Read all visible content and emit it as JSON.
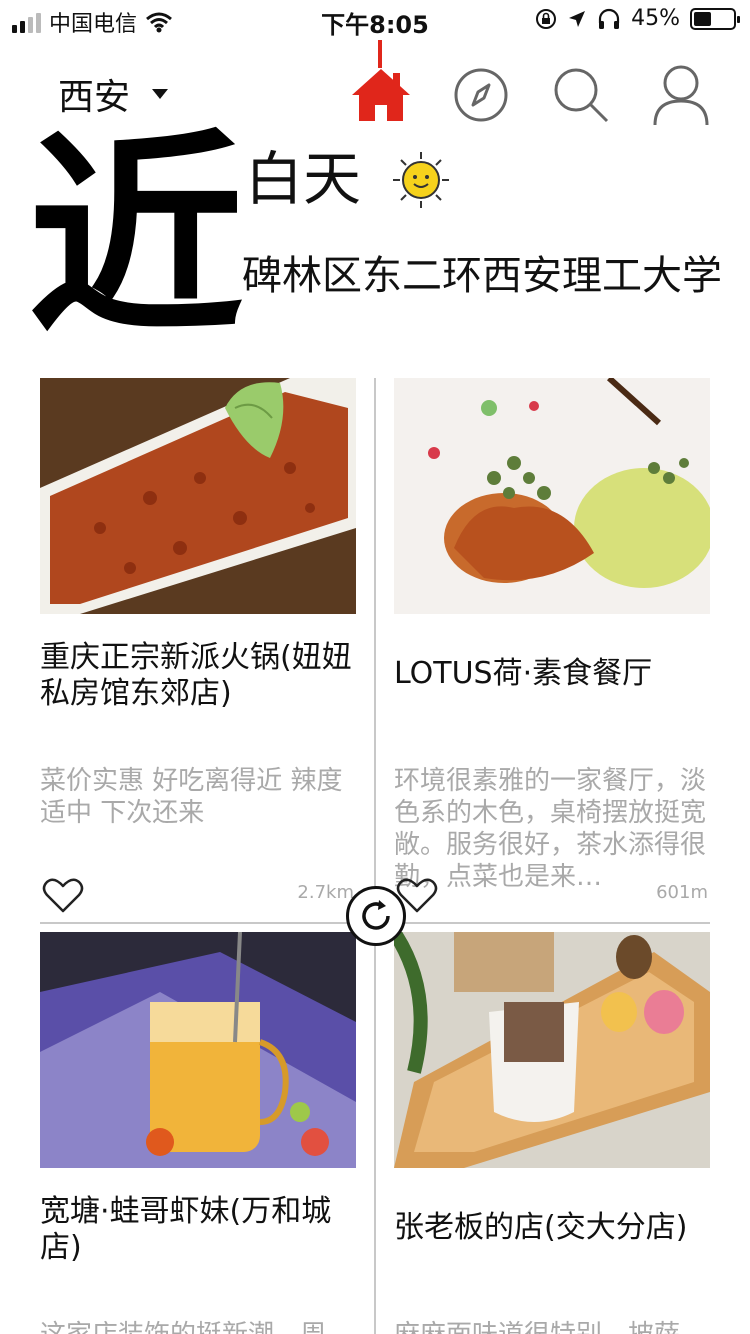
{
  "status_bar": {
    "carrier": "中国电信",
    "time": "下午8:05",
    "battery_percent": "45%",
    "battery_level": 0.45,
    "icons": [
      "signal-icon",
      "wifi-icon",
      "rotation-lock-icon",
      "location-arrow-icon",
      "headphones-icon",
      "battery-icon"
    ]
  },
  "nav": {
    "city": "西安",
    "icons": [
      "home-icon",
      "compass-icon",
      "search-icon",
      "user-icon"
    ],
    "active": "home",
    "accent_color": "#e0261b"
  },
  "hero": {
    "big_char": "近",
    "daytime": "白天",
    "weather_icon": "sun-icon",
    "address": "碑林区东二环西安理工大学"
  },
  "cards": [
    {
      "title": "重庆正宗新派火锅(妞妞私房馆东郊店)",
      "desc": "菜价实惠  好吃离得近  辣度适中 下次还来",
      "distance": "2.7km",
      "photo": "hotpot-meat-platter"
    },
    {
      "title": "LOTUS荷·素食餐厅",
      "desc": "环境很素雅的一家餐厅，淡色系的木色，桌椅摆放挺宽敞。服务很好，茶水添得很勤，点菜也是来…",
      "distance": "601m",
      "photo": "vegetarian-dish"
    },
    {
      "title": "宽塘·蛙哥虾妹(万和城店)",
      "desc": "这家店装饰的挺新潮，周",
      "distance": "",
      "photo": "fruit-drink-pitcher"
    },
    {
      "title": "张老板的店(交大分店)",
      "desc": "麻麻面味道很特别，披萨",
      "distance": "",
      "photo": "drip-coffee-tray"
    }
  ],
  "colors": {
    "divider": "#c8c8c8",
    "secondary_text": "#a9a9a9"
  }
}
